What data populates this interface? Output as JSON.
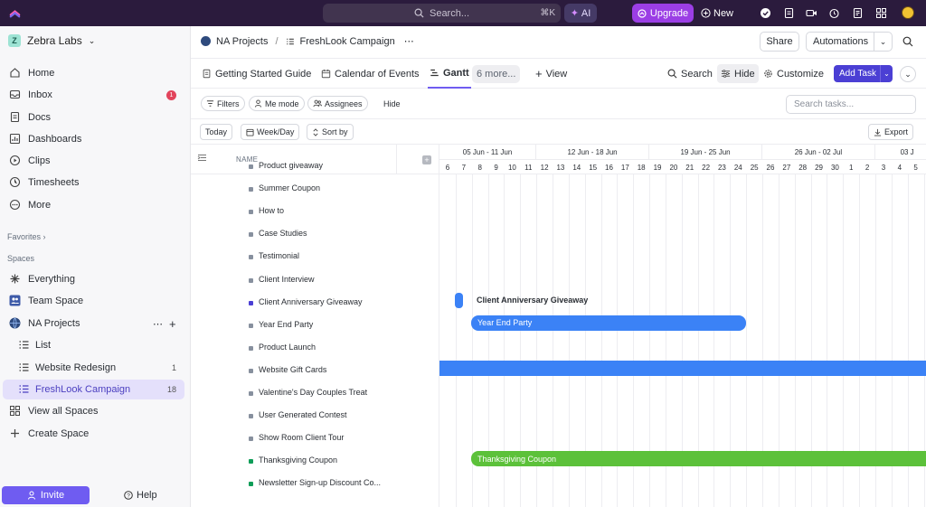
{
  "topbar": {
    "search_placeholder": "Search...",
    "search_shortcut": "⌘K",
    "ai_label": "AI",
    "upgrade_label": "Upgrade",
    "new_label": "New",
    "colors": {
      "bg": "#2b1b3d",
      "upgrade": "#9b3ee5"
    }
  },
  "sidebar": {
    "workspace": "Zebra Labs",
    "workspace_initial": "Z",
    "nav": [
      {
        "label": "Home",
        "icon": "home-icon"
      },
      {
        "label": "Inbox",
        "icon": "inbox-icon",
        "badge": "1"
      },
      {
        "label": "Docs",
        "icon": "docs-icon"
      },
      {
        "label": "Dashboards",
        "icon": "dashboards-icon"
      },
      {
        "label": "Clips",
        "icon": "clips-icon"
      },
      {
        "label": "Timesheets",
        "icon": "timesheets-icon"
      },
      {
        "label": "More",
        "icon": "more-icon"
      }
    ],
    "favorites_label": "Favorites",
    "spaces_label": "Spaces",
    "spaces": [
      {
        "label": "Everything",
        "icon": "everything-icon"
      },
      {
        "label": "Team Space",
        "icon": "team-icon"
      },
      {
        "label": "NA Projects",
        "icon": "globe-icon"
      },
      {
        "label": "List",
        "icon": "list-icon"
      },
      {
        "label": "Website Redesign",
        "icon": "list-icon",
        "count": "1"
      },
      {
        "label": "FreshLook Campaign",
        "icon": "list-icon",
        "count": "18",
        "active": true
      },
      {
        "label": "View all Spaces",
        "icon": "grid-icon"
      },
      {
        "label": "Create Space",
        "icon": "plus-icon"
      }
    ],
    "invite_label": "Invite",
    "help_label": "Help"
  },
  "header": {
    "breadcrumb_space": "NA Projects",
    "breadcrumb_sep": "/",
    "breadcrumb_list": "FreshLook Campaign",
    "share_label": "Share",
    "automations_label": "Automations"
  },
  "tabs": {
    "items": [
      "Getting Started Guide",
      "Calendar of Events",
      "Gantt"
    ],
    "more_label": "6 more...",
    "view_label": "View",
    "search_label": "Search",
    "hide_label": "Hide",
    "customize_label": "Customize",
    "add_task_label": "Add Task"
  },
  "filters": {
    "filters_label": "Filters",
    "me_mode_label": "Me mode",
    "assignees_label": "Assignees",
    "hide_label": "Hide",
    "search_placeholder": "Search tasks..."
  },
  "controls": {
    "today_label": "Today",
    "week_day_label": "Week/Day",
    "sort_label": "Sort by",
    "export_label": "Export"
  },
  "list": {
    "name_header": "NAME",
    "tasks": [
      {
        "name": "Product giveaway",
        "color": "#87909e"
      },
      {
        "name": "Summer Coupon",
        "color": "#87909e"
      },
      {
        "name": "How to",
        "color": "#87909e"
      },
      {
        "name": "Case Studies",
        "color": "#87909e"
      },
      {
        "name": "Testimonial",
        "color": "#87909e"
      },
      {
        "name": "Client Interview",
        "color": "#87909e"
      },
      {
        "name": "Client Anniversary Giveaway",
        "color": "#4b3fd4"
      },
      {
        "name": "Year End Party",
        "color": "#87909e"
      },
      {
        "name": "Product Launch",
        "color": "#87909e"
      },
      {
        "name": "Website Gift Cards",
        "color": "#87909e"
      },
      {
        "name": "Valentine's Day Couples Treat",
        "color": "#87909e"
      },
      {
        "name": "User Generated Contest",
        "color": "#87909e"
      },
      {
        "name": "Show Room Client Tour",
        "color": "#87909e"
      },
      {
        "name": "Thanksgiving Coupon",
        "color": "#0f9d58"
      },
      {
        "name": "Newsletter Sign-up Discount Co...",
        "color": "#0f9d58"
      }
    ]
  },
  "gantt": {
    "weeks": [
      "05 Jun - 11 Jun",
      "12 Jun - 18 Jun",
      "19 Jun - 25 Jun",
      "26 Jun - 02 Jul",
      "03 J"
    ],
    "days": [
      "6",
      "7",
      "8",
      "9",
      "10",
      "11",
      "12",
      "13",
      "14",
      "15",
      "16",
      "17",
      "18",
      "19",
      "20",
      "21",
      "22",
      "23",
      "24",
      "25",
      "26",
      "27",
      "28",
      "29",
      "30",
      "1",
      "2",
      "3",
      "4",
      "5"
    ],
    "bars": [
      {
        "task": "Client Anniversary Giveaway",
        "label": "Client Anniversary Giveaway",
        "color": "#3b82f6"
      },
      {
        "task": "Year End Party",
        "label": "Year End Party",
        "color": "#3b82f6"
      },
      {
        "task": "Website Gift Cards",
        "label": "",
        "color": "#3b82f6"
      },
      {
        "task": "Thanksgiving Coupon",
        "label": "Thanksgiving Coupon",
        "color": "#5cc13a"
      }
    ]
  }
}
